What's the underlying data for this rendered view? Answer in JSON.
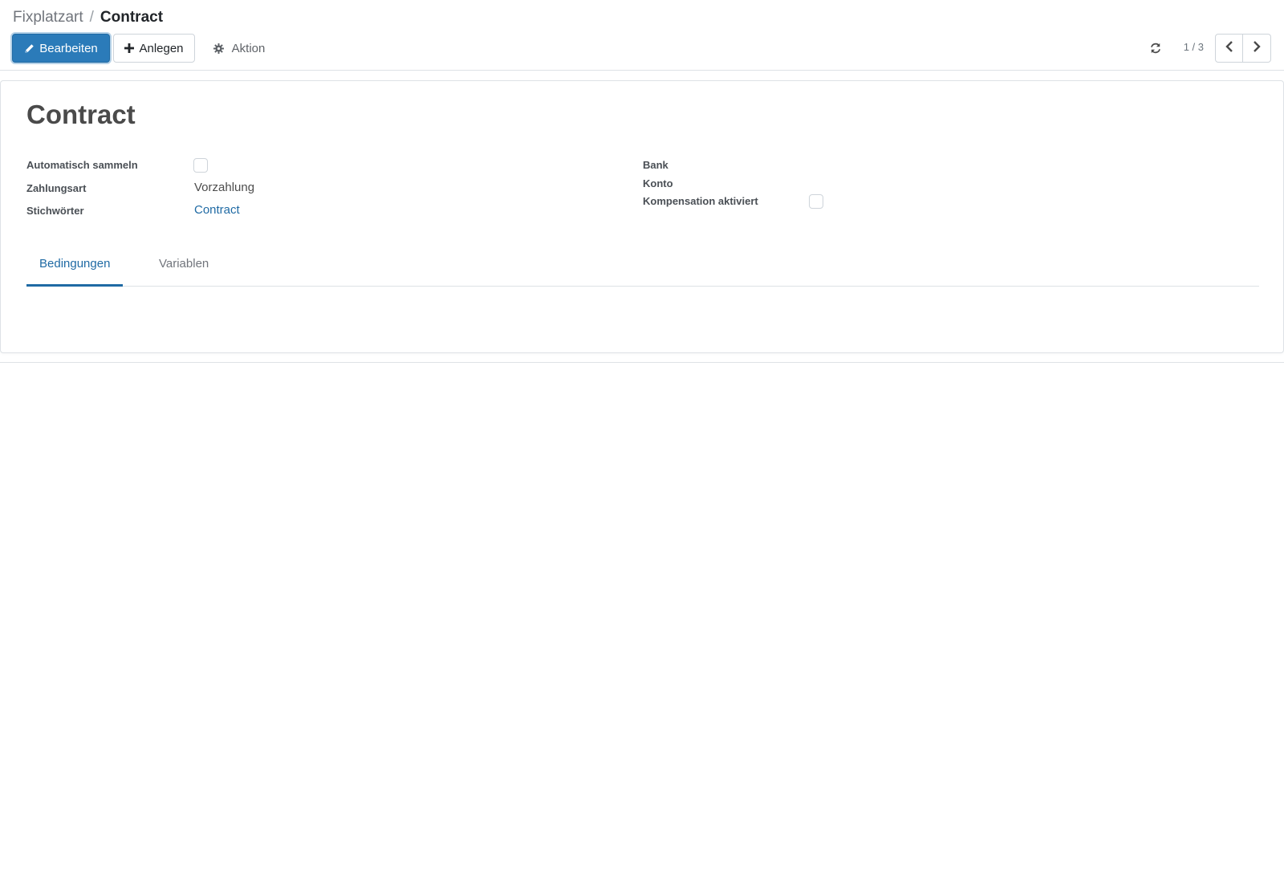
{
  "breadcrumb": {
    "parent": "Fixplatzart",
    "separator": "/",
    "current": "Contract"
  },
  "toolbar": {
    "edit_label": "Bearbeiten",
    "create_label": "Anlegen",
    "action_label": "Aktion",
    "edit_icon": "pencil-icon",
    "create_icon": "plus-icon",
    "action_icon": "gear-icon"
  },
  "pager": {
    "value": "1 / 3",
    "refresh_icon": "refresh-icon",
    "prev_icon": "chevron-left-icon",
    "next_icon": "chevron-right-icon"
  },
  "record": {
    "title": "Contract"
  },
  "fields_left": {
    "auto_collect_label": "Automatisch sammeln",
    "auto_collect_checked": false,
    "payment_type_label": "Zahlungsart",
    "payment_type_value": "Vorzahlung",
    "keywords_label": "Stichwörter",
    "keywords_value": "Contract"
  },
  "fields_right": {
    "bank_label": "Bank",
    "account_label": "Konto",
    "compensation_label": "Kompensation aktiviert",
    "compensation_checked": false
  },
  "tabs": {
    "active": "Bedingungen",
    "inactive": "Variablen"
  },
  "colors": {
    "primary": "#2b7bb9",
    "link": "#1f6aa4",
    "border": "#dee2e6"
  }
}
